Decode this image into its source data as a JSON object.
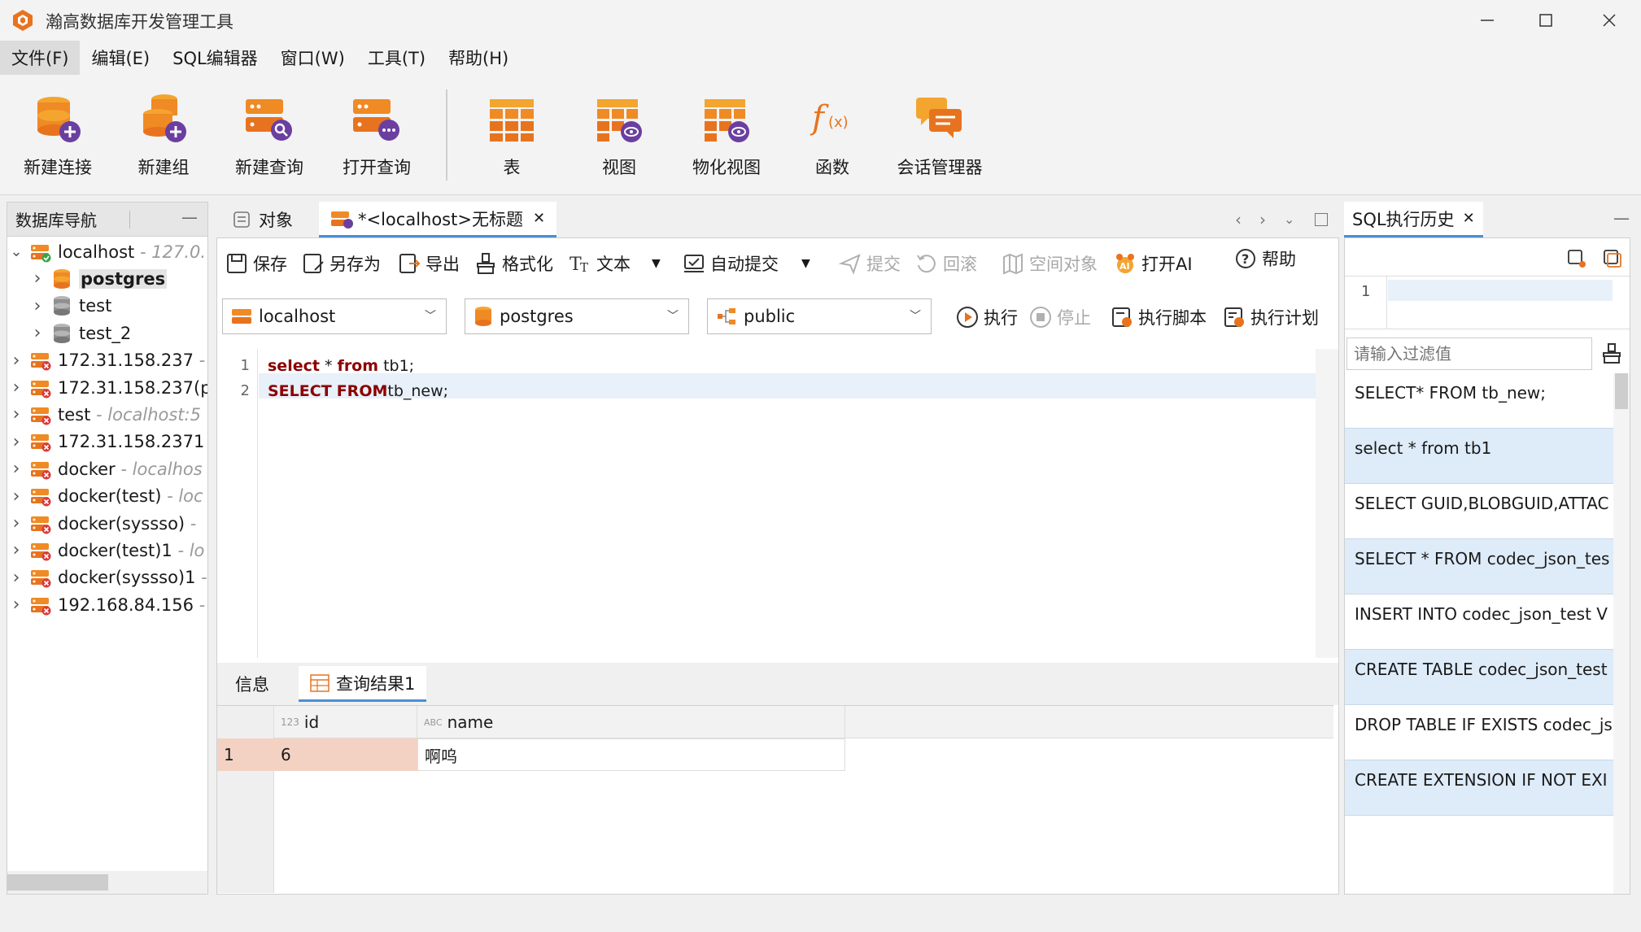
{
  "window": {
    "title": "瀚高数据库开发管理工具"
  },
  "menu": [
    "文件(F)",
    "编辑(E)",
    "SQL编辑器",
    "窗口(W)",
    "工具(T)",
    "帮助(H)"
  ],
  "ribbon": {
    "new_connection": "新建连接",
    "new_group": "新建组",
    "new_query": "新建查询",
    "open_query": "打开查询",
    "table": "表",
    "view": "视图",
    "mat_view": "物化视图",
    "function": "函数",
    "session_mgr": "会话管理器"
  },
  "nav": {
    "title": "数据库导航",
    "items": [
      {
        "name": "localhost",
        "sub": " - 127.0.",
        "level": 0,
        "expanded": true,
        "connected": true
      },
      {
        "name": "postgres",
        "sub": "",
        "level": 1,
        "db": true,
        "selected": true
      },
      {
        "name": "test",
        "sub": "",
        "level": 1,
        "db": true
      },
      {
        "name": "test_2",
        "sub": "",
        "level": 1,
        "db": true
      },
      {
        "name": "172.31.158.237",
        "sub": " -",
        "level": 0
      },
      {
        "name": "172.31.158.237(p",
        "sub": "",
        "level": 0
      },
      {
        "name": "test",
        "sub": " - localhost:5",
        "level": 0
      },
      {
        "name": "172.31.158.2371",
        "sub": " -",
        "level": 0
      },
      {
        "name": "docker",
        "sub": " - localhos",
        "level": 0
      },
      {
        "name": "docker(test)",
        "sub": " - loc",
        "level": 0
      },
      {
        "name": "docker(syssso)",
        "sub": " - ",
        "level": 0
      },
      {
        "name": "docker(test)1",
        "sub": " - lo",
        "level": 0
      },
      {
        "name": "docker(syssso)1",
        "sub": " -",
        "level": 0
      },
      {
        "name": "192.168.84.156",
        "sub": " -",
        "level": 0
      }
    ]
  },
  "tabs": {
    "objects": "对象",
    "editor": "*<localhost>无标题",
    "close": "✕"
  },
  "toolbar": {
    "save": "保存",
    "save_as": "另存为",
    "export": "导出",
    "format": "格式化",
    "text": "文本",
    "auto_commit": "自动提交",
    "commit": "提交",
    "rollback": "回滚",
    "spatial": "空间对象",
    "open_ai": "打开AI",
    "help": "帮助"
  },
  "selectors": {
    "connection": "localhost",
    "database": "postgres",
    "schema": "public"
  },
  "exec": {
    "run": "执行",
    "stop": "停止",
    "run_script": "执行脚本",
    "plan": "执行计划"
  },
  "code": {
    "lines": [
      {
        "n": "1",
        "kw1": "select",
        "t1": " * ",
        "kw2": "from",
        "t2": " tb1;"
      },
      {
        "n": "2",
        "kw1": "SELECT",
        "t1": " ",
        "kw2": "FROM",
        "t2": "tb_new;"
      }
    ]
  },
  "results": {
    "tab_info": "信息",
    "tab_result": "查询结果1",
    "columns": [
      {
        "type": "123",
        "name": "id"
      },
      {
        "type": "ABC",
        "name": "name"
      }
    ],
    "rows": [
      {
        "num": "1",
        "id": "6",
        "name": "啊呜"
      }
    ]
  },
  "history": {
    "title": "SQL执行历史",
    "line_number": "1",
    "filter_placeholder": "请输入过滤值",
    "items": [
      "SELECT* FROM tb_new;",
      "select * from tb1",
      "SELECT GUID,BLOBGUID,ATTAC",
      "SELECT * FROM codec_json_tes",
      "INSERT INTO codec_json_test V",
      "CREATE TABLE codec_json_test",
      "DROP TABLE IF EXISTS codec_js",
      "CREATE EXTENSION IF NOT EXI"
    ]
  }
}
